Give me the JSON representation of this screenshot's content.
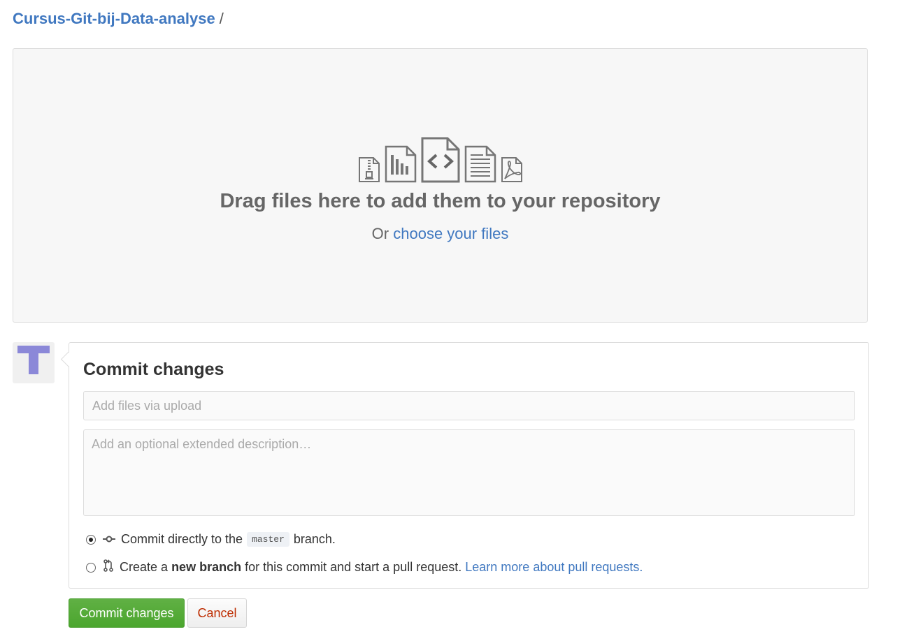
{
  "breadcrumb": {
    "repo": "Cursus-Git-bij-Data-analyse",
    "separator": "/"
  },
  "dropzone": {
    "icons": [
      "file-zip-icon",
      "file-chart-icon",
      "file-code-icon",
      "file-text-icon",
      "file-pdf-icon"
    ],
    "title": "Drag files here to add them to your repository",
    "sub_prefix": "Or",
    "sub_link": "choose your files"
  },
  "avatar": {
    "letter": "T",
    "color": "#8b88d8"
  },
  "commit": {
    "title": "Commit changes",
    "summary_placeholder": "Add files via upload",
    "summary_value": "",
    "description_placeholder": "Add an optional extended description…",
    "description_value": "",
    "option_direct": {
      "prefix": "Commit directly to the",
      "branch": "master",
      "suffix": "branch.",
      "selected": true
    },
    "option_new": {
      "prefix": "Create a",
      "bold": "new branch",
      "suffix": "for this commit and start a pull request.",
      "link": "Learn more about pull requests.",
      "selected": false
    }
  },
  "buttons": {
    "commit": "Commit changes",
    "cancel": "Cancel"
  },
  "colors": {
    "link": "#4078c0",
    "primary": "#55a532",
    "cancel_text": "#bd2c00"
  }
}
